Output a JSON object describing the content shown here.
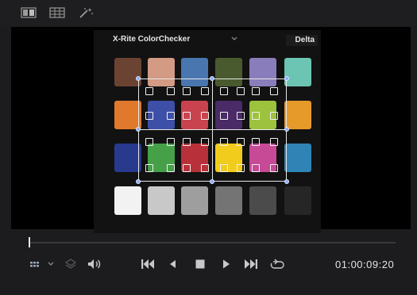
{
  "toolbar": {
    "icons": [
      "single-viewer-icon",
      "gallery-grid-icon",
      "magic-wand-icon"
    ]
  },
  "color_chart": {
    "name": "X-Rite ColorChecker",
    "delta_label": "Delta",
    "patch_colors": [
      [
        "#6b4332",
        "#d39a84",
        "#4a76b0",
        "#495b2e",
        "#8a7dbb",
        "#6cc4b2"
      ],
      [
        "#e1792c",
        "#3d4fa7",
        "#c9434f",
        "#4a2a67",
        "#9dc23d",
        "#e69a2a"
      ],
      [
        "#283a8e",
        "#45a048",
        "#b8313a",
        "#f2cc1c",
        "#c74a96",
        "#2f84b5"
      ],
      [
        "#f2f2f2",
        "#c8c8c8",
        "#9e9e9e",
        "#747474",
        "#4b4b4b",
        "#262626"
      ]
    ]
  },
  "transport": {
    "icons": [
      "viewer-layout-icon",
      "dropdown-arrow-icon",
      "layers-icon",
      "volume-icon",
      "skip-to-start-icon",
      "step-back-icon",
      "stop-icon",
      "play-icon",
      "skip-to-end-icon",
      "loop-icon"
    ],
    "timecode": "01:00:09:20",
    "playhead_fraction": 0.0
  }
}
